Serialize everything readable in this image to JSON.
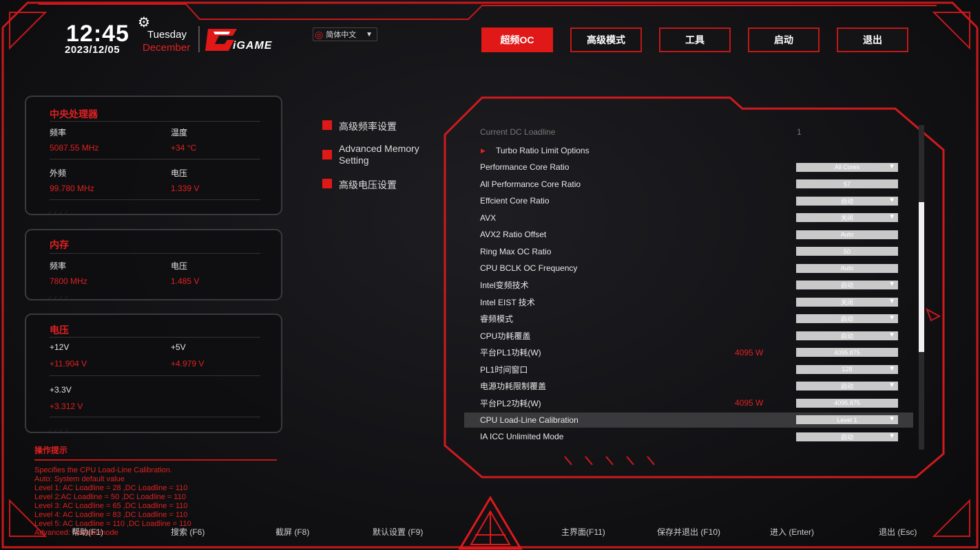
{
  "header": {
    "time": "12:45",
    "date": "2023/12/05",
    "weekday": "Tuesday",
    "month": "December",
    "brand": "iGAME",
    "language": "简体中文"
  },
  "tabs": [
    {
      "label": "超频OC",
      "active": true
    },
    {
      "label": "高级模式",
      "active": false
    },
    {
      "label": "工具",
      "active": false
    },
    {
      "label": "启动",
      "active": false
    },
    {
      "label": "退出",
      "active": false
    }
  ],
  "cpu_panel": {
    "title": "中央处理器",
    "freq_label": "频率",
    "freq_value": "5087.55 MHz",
    "temp_label": "温度",
    "temp_value": "+34 °C",
    "bclk_label": "外频",
    "bclk_value": "99.780 MHz",
    "volt_label": "电压",
    "volt_value": "1.339 V"
  },
  "mem_panel": {
    "title": "内存",
    "freq_label": "频率",
    "freq_value": "7800 MHz",
    "volt_label": "电压",
    "volt_value": "1.485 V"
  },
  "volt_panel": {
    "title": "电压",
    "v12_label": "+12V",
    "v12_value": "+11.904 V",
    "v5_label": "+5V",
    "v5_value": "+4.979 V",
    "v33_label": "+3.3V",
    "v33_value": "+3.312 V"
  },
  "menu": [
    {
      "label": "高级频率设置"
    },
    {
      "label": "Advanced Memory Setting"
    },
    {
      "label": "高级电压设置"
    }
  ],
  "settings": {
    "dim_row": {
      "name": "Current DC Loadline",
      "value": "1"
    },
    "submenu": "Turbo Ratio Limit Options",
    "rows": [
      {
        "name": "Performance Core Ratio",
        "value": "All Cores",
        "dropdown": true
      },
      {
        "name": "All Performance Core Ratio",
        "value": "57",
        "dropdown": false
      },
      {
        "name": "Effcient Core Ratio",
        "value": "自动",
        "dropdown": true
      },
      {
        "name": "AVX",
        "value": "关闭",
        "dropdown": true
      },
      {
        "name": "AVX2 Ratio Offset",
        "value": "Auto",
        "dropdown": false
      },
      {
        "name": "Ring Max OC Ratio",
        "value": "50",
        "dropdown": false
      },
      {
        "name": "CPU BCLK OC Frequency",
        "value": "Auto",
        "dropdown": false
      },
      {
        "name": "Intel变频技术",
        "value": "启动",
        "dropdown": true
      },
      {
        "name": "Intel EIST 技术",
        "value": "关闭",
        "dropdown": true
      },
      {
        "name": "睿频模式",
        "value": "启动",
        "dropdown": true
      },
      {
        "name": "CPU功耗覆盖",
        "value": "启动",
        "dropdown": true
      },
      {
        "name": "平台PL1功耗(W)",
        "value": "4095.875",
        "extra": "4095 W",
        "dropdown": false
      },
      {
        "name": "PL1时间窗口",
        "value": "128",
        "dropdown": true
      },
      {
        "name": "电源功耗限制覆盖",
        "value": "启动",
        "dropdown": true
      },
      {
        "name": "平台PL2功耗(W)",
        "value": "4095.875",
        "extra": "4095 W",
        "dropdown": false
      },
      {
        "name": "CPU Load-Line Calibration",
        "value": "Level 1",
        "dropdown": true,
        "selected": true
      },
      {
        "name": "IA ICC Unlimited Mode",
        "value": "启动",
        "dropdown": true
      }
    ]
  },
  "help": {
    "title": "操作提示",
    "lines": [
      "Specifies the CPU Load-Line Calibration.",
      "Auto: System default value",
      "Level 1: AC Loadline = 28 ,DC Loadline = 110",
      "Level 2:AC Loadline = 50 ,DC Loadline = 110",
      "Level 3: AC Loadline = 65 ,DC Loadline = 110",
      "Level 4: AC Loadline = 83 ,DC Loadline = 110",
      "Level 5: AC Loadline = 110 ,DC Loadline = 110",
      "Advanced: Manual mode"
    ]
  },
  "footer": {
    "help": "帮助(F1)",
    "search": "搜索 (F6)",
    "screenshot": "截屏 (F8)",
    "defaults": "默认设置 (F9)",
    "main": "主界面(F11)",
    "save_exit": "保存并退出 (F10)",
    "enter": "进入 (Enter)",
    "exit": "退出 (Esc)"
  },
  "colors": {
    "accent": "#e01818",
    "background": "#0e0e10",
    "control": "#c9c9c9"
  }
}
